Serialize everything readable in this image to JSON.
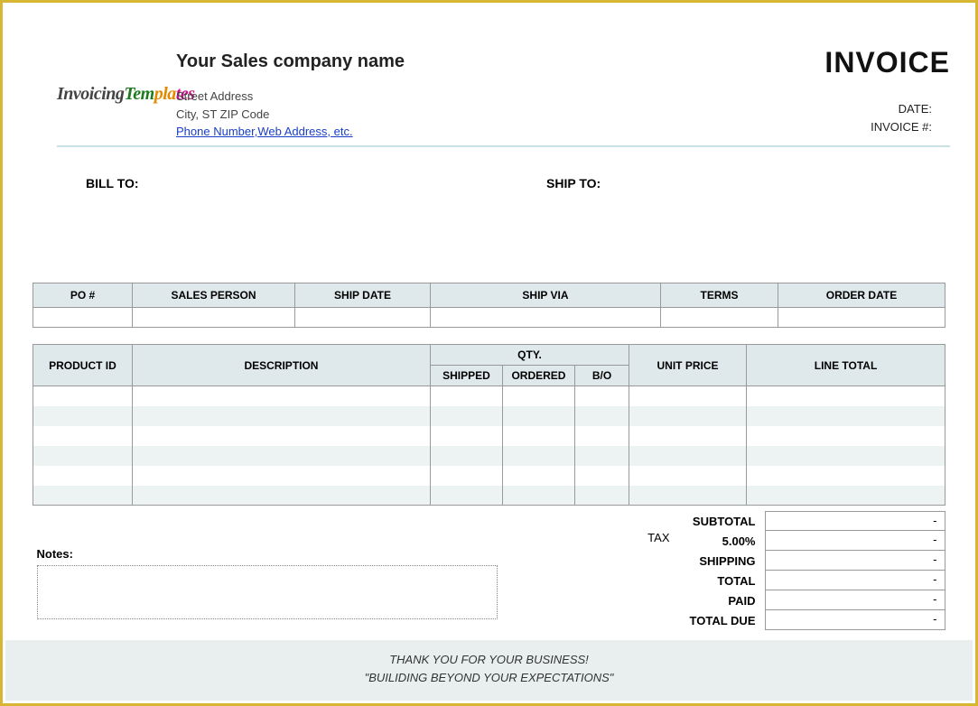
{
  "header": {
    "company_name": "Your Sales company name",
    "street": "Street Address",
    "city_line": "City, ST  ZIP Code",
    "link_text": "Phone Number,Web Address, etc.",
    "title": "INVOICE",
    "date_label": "DATE:",
    "invno_label": "INVOICE #:"
  },
  "logo": {
    "p1": "Invoicing",
    "p2": "Tem",
    "p3": "pla",
    "p4": "tes"
  },
  "addr": {
    "billto": "BILL TO:",
    "shipto": "SHIP TO:"
  },
  "meta_cols": [
    "PO #",
    "SALES PERSON",
    "SHIP DATE",
    "SHIP VIA",
    "TERMS",
    "ORDER DATE"
  ],
  "items_header": {
    "product_id": "PRODUCT ID",
    "description": "DESCRIPTION",
    "qty_group": "QTY.",
    "shipped": "SHIPPED",
    "ordered": "ORDERED",
    "bo": "B/O",
    "unit_price": "UNIT PRICE",
    "line_total": "LINE TOTAL"
  },
  "bottom": {
    "notes_label": "Notes:",
    "tax_word": "TAX",
    "rows": {
      "subtotal_label": "SUBTOTAL",
      "subtotal_val": "-",
      "taxrate_label": "5.00%",
      "taxrate_val": "-",
      "shipping_label": "SHIPPING",
      "shipping_val": "-",
      "total_label": "TOTAL",
      "total_val": "-",
      "paid_label": "PAID",
      "paid_val": "-",
      "due_label": "TOTAL DUE",
      "due_val": "-"
    }
  },
  "footer": {
    "line1": "THANK YOU FOR YOUR BUSINESS!",
    "line2": "\"BUILIDING BEYOND YOUR EXPECTATIONS\""
  }
}
